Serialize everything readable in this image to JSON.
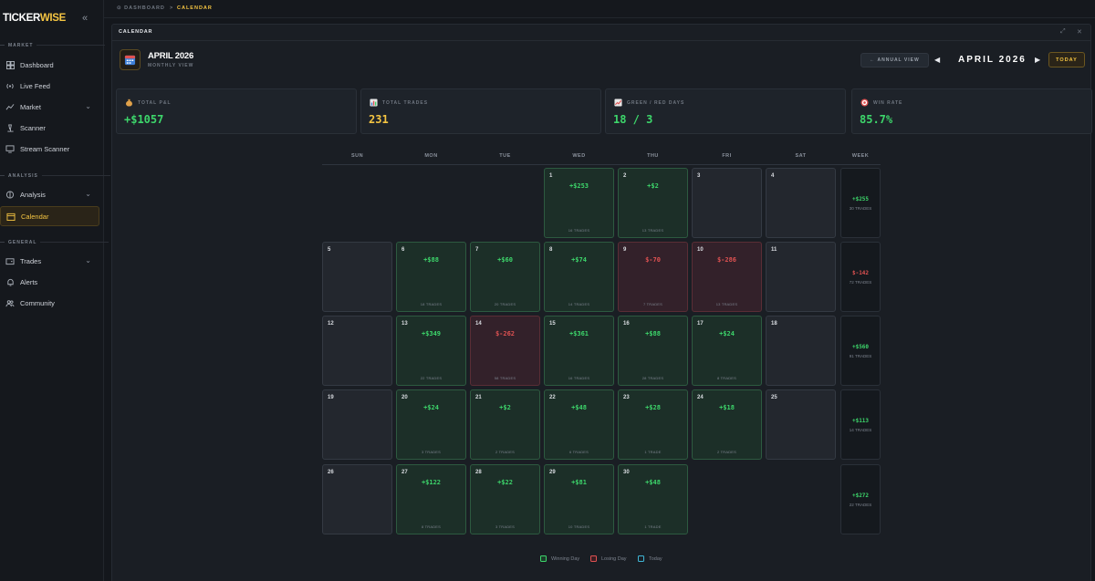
{
  "brand": {
    "name_a": "TICKER",
    "name_b": "WISE"
  },
  "sidebar": {
    "sections": [
      "MARKET",
      "ANALYSIS",
      "GENERAL"
    ],
    "items": [
      {
        "label": "Dashboard",
        "icon": "dashboard-icon"
      },
      {
        "label": "Live Feed",
        "icon": "broadcast-icon"
      },
      {
        "label": "Market",
        "icon": "chart-line-icon"
      },
      {
        "label": "Scanner",
        "icon": "microscope-icon"
      },
      {
        "label": "Stream Scanner",
        "icon": "monitor-icon"
      },
      {
        "label": "Analysis",
        "icon": "brain-icon"
      },
      {
        "label": "Calendar",
        "icon": "calendar-icon"
      },
      {
        "label": "Trades",
        "icon": "wallet-icon"
      },
      {
        "label": "Alerts",
        "icon": "bell-icon"
      },
      {
        "label": "Community",
        "icon": "users-icon"
      }
    ]
  },
  "breadcrumb": {
    "home": "DASHBOARD",
    "separator": ">",
    "current": "CALENDAR"
  },
  "panel": {
    "title": "CALENDAR",
    "month_title": "APRIL 2026",
    "month_subtitle": "MONTHLY VIEW",
    "annual_button": "← ANNUAL VIEW",
    "nav_month": "APRIL 2026",
    "today_button": "TODAY"
  },
  "stats": [
    {
      "label": "TOTAL P&L",
      "value": "+$1057",
      "icon": "money-bag-icon",
      "color": "#3dd66b"
    },
    {
      "label": "TOTAL TRADES",
      "value": "231",
      "icon": "bar-chart-icon",
      "color": "#f5c542"
    },
    {
      "label": "GREEN / RED DAYS",
      "value": "18 / 3",
      "icon": "trend-chart-icon",
      "color": "#3dd66b"
    },
    {
      "label": "WIN RATE",
      "value": "85.7%",
      "icon": "target-icon",
      "color": "#3dd66b"
    }
  ],
  "weekdays": [
    "SUN",
    "MON",
    "TUE",
    "WED",
    "THU",
    "FRI",
    "SAT",
    "WEEK"
  ],
  "calendar": {
    "weeks": [
      {
        "days": [
          null,
          null,
          null,
          {
            "num": "1",
            "pnl": "+$253",
            "trades": "16 TRADES",
            "state": "win"
          },
          {
            "num": "2",
            "pnl": "+$2",
            "trades": "13 TRADES",
            "state": "win"
          },
          {
            "num": "3",
            "pnl": "",
            "trades": "",
            "state": "empty"
          },
          {
            "num": "4",
            "pnl": "",
            "trades": "",
            "state": "empty"
          }
        ],
        "total": {
          "pnl": "+$255",
          "trades": "30 TRADES",
          "state": "win"
        }
      },
      {
        "days": [
          {
            "num": "5",
            "pnl": "",
            "trades": "",
            "state": "empty"
          },
          {
            "num": "6",
            "pnl": "+$88",
            "trades": "18 TRADES",
            "state": "win"
          },
          {
            "num": "7",
            "pnl": "+$60",
            "trades": "20 TRADES",
            "state": "win"
          },
          {
            "num": "8",
            "pnl": "+$74",
            "trades": "14 TRADES",
            "state": "win"
          },
          {
            "num": "9",
            "pnl": "$-70",
            "trades": "7 TRADES",
            "state": "loss"
          },
          {
            "num": "10",
            "pnl": "$-286",
            "trades": "13 TRADES",
            "state": "loss"
          },
          {
            "num": "11",
            "pnl": "",
            "trades": "",
            "state": "empty"
          }
        ],
        "total": {
          "pnl": "$-142",
          "trades": "72 TRADES",
          "state": "loss"
        }
      },
      {
        "days": [
          {
            "num": "12",
            "pnl": "",
            "trades": "",
            "state": "empty"
          },
          {
            "num": "13",
            "pnl": "+$349",
            "trades": "22 TRADES",
            "state": "win"
          },
          {
            "num": "14",
            "pnl": "$-262",
            "trades": "58 TRADES",
            "state": "loss"
          },
          {
            "num": "15",
            "pnl": "+$361",
            "trades": "16 TRADES",
            "state": "win"
          },
          {
            "num": "16",
            "pnl": "+$88",
            "trades": "28 TRADES",
            "state": "win"
          },
          {
            "num": "17",
            "pnl": "+$24",
            "trades": "8 TRADES",
            "state": "win"
          },
          {
            "num": "18",
            "pnl": "",
            "trades": "",
            "state": "empty"
          }
        ],
        "total": {
          "pnl": "+$560",
          "trades": "91 TRADES",
          "state": "win"
        }
      },
      {
        "days": [
          {
            "num": "19",
            "pnl": "",
            "trades": "",
            "state": "empty"
          },
          {
            "num": "20",
            "pnl": "+$24",
            "trades": "3 TRADES",
            "state": "win"
          },
          {
            "num": "21",
            "pnl": "+$2",
            "trades": "2 TRADES",
            "state": "win"
          },
          {
            "num": "22",
            "pnl": "+$48",
            "trades": "6 TRADES",
            "state": "win"
          },
          {
            "num": "23",
            "pnl": "+$28",
            "trades": "1 TRADE",
            "state": "win"
          },
          {
            "num": "24",
            "pnl": "+$18",
            "trades": "2 TRADES",
            "state": "win"
          },
          {
            "num": "25",
            "pnl": "",
            "trades": "",
            "state": "empty"
          }
        ],
        "total": {
          "pnl": "+$113",
          "trades": "14 TRADES",
          "state": "win"
        }
      },
      {
        "days": [
          {
            "num": "26",
            "pnl": "",
            "trades": "",
            "state": "empty"
          },
          {
            "num": "27",
            "pnl": "+$122",
            "trades": "8 TRADES",
            "state": "win"
          },
          {
            "num": "28",
            "pnl": "+$22",
            "trades": "3 TRADES",
            "state": "win"
          },
          {
            "num": "29",
            "pnl": "+$81",
            "trades": "10 TRADES",
            "state": "win"
          },
          {
            "num": "30",
            "pnl": "+$48",
            "trades": "1 TRADE",
            "state": "win"
          },
          null,
          null
        ],
        "total": {
          "pnl": "+$272",
          "trades": "22 TRADES",
          "state": "win"
        }
      }
    ]
  },
  "legend": [
    {
      "label": "Winning Day",
      "color": "#2d7a4a",
      "border": "#3dd66b"
    },
    {
      "label": "Losing Day",
      "color": "#7a2d35",
      "border": "#e05252"
    },
    {
      "label": "Today",
      "color": "transparent",
      "border": "#3fb6d6"
    }
  ]
}
